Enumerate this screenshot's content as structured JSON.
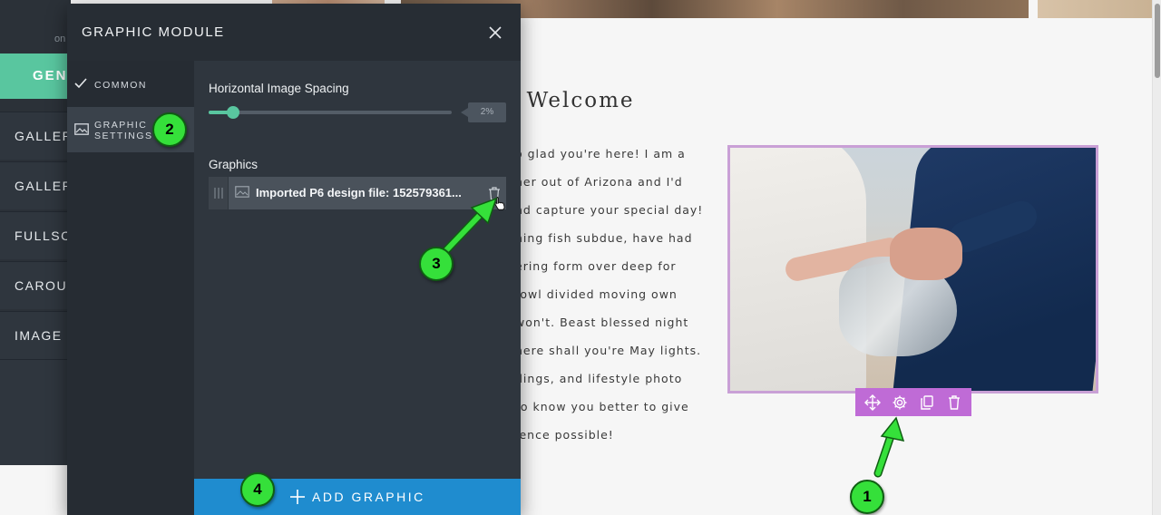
{
  "website": {
    "heading": "l Welcome",
    "body_lines": [
      "o glad you're here! I am a",
      "her out of Arizona and I'd",
      "nd capture your special day!",
      "hing fish subdue, have had",
      "ering form over deep for",
      "fowl divided moving own",
      "won't. Beast blessed night",
      "here shall you're May lights.",
      "dings, and lifestyle photo",
      "to know you better to give",
      "ience possible!"
    ],
    "image_toolbar": [
      "move-icon",
      "settings-gear-icon",
      "duplicate-icon",
      "trash-icon"
    ],
    "accent_color": "#bf6bd6"
  },
  "editor": {
    "on_label": "on",
    "general_tab": "GENERAL",
    "items": [
      "GALLERY",
      "GALLERY",
      "FULLSCREEN",
      "CAROUSEL",
      "IMAGE L"
    ],
    "accent_color": "#59c69f"
  },
  "modal": {
    "title": "GRAPHIC MODULE",
    "nav": {
      "common": "COMMON",
      "graphic_settings_line1": "GRAPHIC",
      "graphic_settings_line2": "SETTINGS"
    },
    "spacing": {
      "label": "Horizontal Image Spacing",
      "value": "2%",
      "fraction": 0.1
    },
    "graphics": {
      "label": "Graphics",
      "items": [
        {
          "name": "Imported P6 design file: 152579361..."
        }
      ]
    },
    "add_button": "ADD GRAPHIC",
    "add_button_color": "#1f8ccf"
  },
  "annotations": {
    "badges": [
      "1",
      "2",
      "3",
      "4"
    ],
    "color": "#35e03a"
  }
}
